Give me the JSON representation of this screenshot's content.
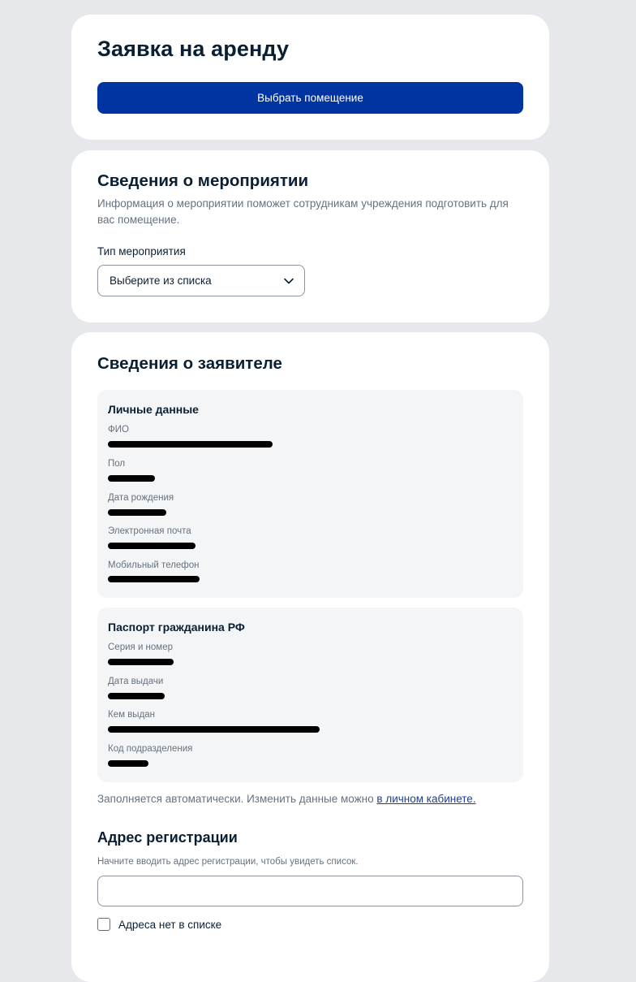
{
  "rent": {
    "title": "Заявка на аренду",
    "select_room_button": "Выбрать помещение"
  },
  "event": {
    "title": "Сведения о мероприятии",
    "description": "Информация о мероприятии поможет сотрудникам учреждения подготовить для вас помещение.",
    "type_label": "Тип мероприятия",
    "type_select_value": "Выберите из списка",
    "icon": "chevron-down-icon"
  },
  "applicant": {
    "title": "Сведения о заявителе",
    "personal": {
      "title": "Личные данные",
      "fields": [
        {
          "label": "ФИО"
        },
        {
          "label": "Пол"
        },
        {
          "label": "Дата рождения"
        },
        {
          "label": "Электронная почта"
        },
        {
          "label": "Мобильный телефон"
        }
      ]
    },
    "passport": {
      "title": "Паспорт гражданина РФ",
      "fields": [
        {
          "label": "Серия и номер"
        },
        {
          "label": "Дата выдачи"
        },
        {
          "label": "Кем выдан"
        },
        {
          "label": "Код подразделения"
        }
      ]
    },
    "auto_note": "Заполняется автоматически. Изменить данные можно ",
    "auto_note_link": "в личном кабинете."
  },
  "address": {
    "title": "Адрес регистрации",
    "hint": "Начните вводить адрес регистрации, чтобы увидеть список.",
    "input_value": "",
    "no_address_checkbox_label": "Адреса нет в списке",
    "no_address_checked": false
  },
  "colors": {
    "primary": "#0034a1",
    "page_bg": "#e6e8ec",
    "panel_bg": "#f4f5f7"
  }
}
